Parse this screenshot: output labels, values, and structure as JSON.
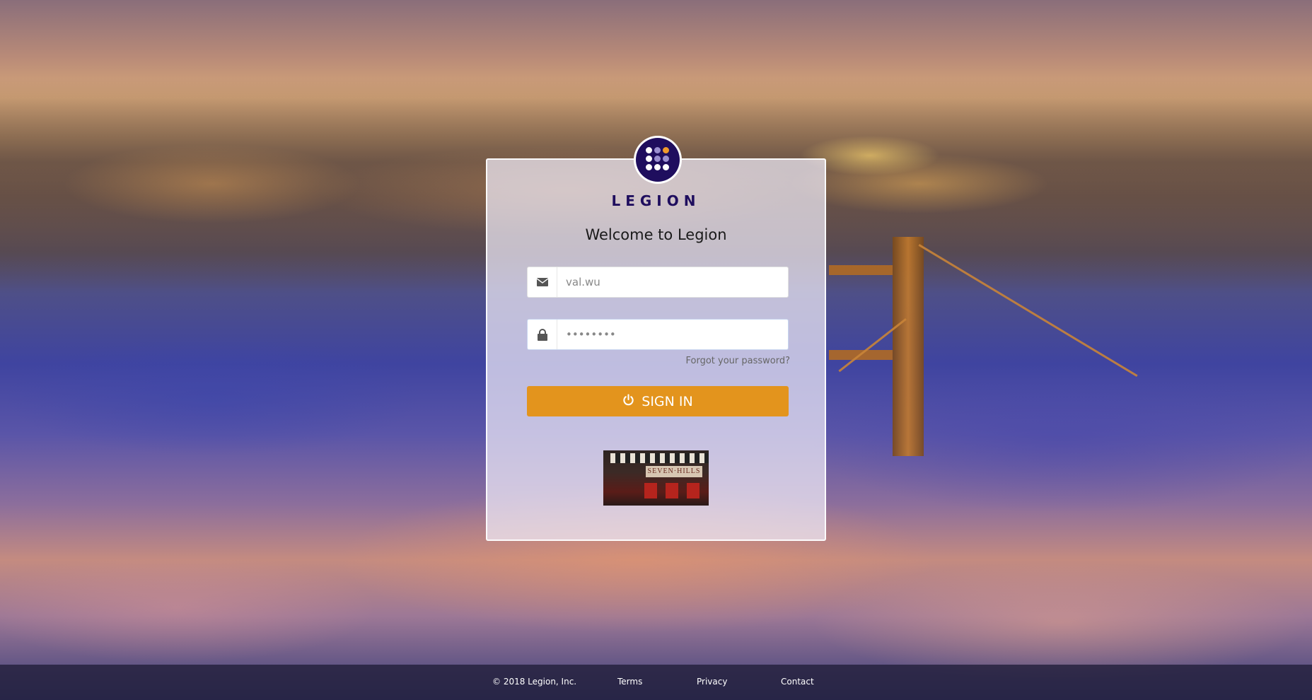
{
  "brand": {
    "name": "LEGION",
    "logo_icon": "legion-dots-logo"
  },
  "login": {
    "welcome": "Welcome to Legion",
    "email": {
      "value": "val.wu",
      "icon": "envelope-icon"
    },
    "password": {
      "value": "••••••••",
      "icon": "lock-icon"
    },
    "forgot_label": "Forgot your password?",
    "signin_label": "SIGN IN",
    "signin_icon": "power-icon",
    "accent_color": "#e3941d",
    "tenant_sign_text": "SEVEN·HILLS"
  },
  "footer": {
    "copyright": "© 2018 Legion, Inc.",
    "links": [
      "Terms",
      "Privacy",
      "Contact"
    ]
  }
}
